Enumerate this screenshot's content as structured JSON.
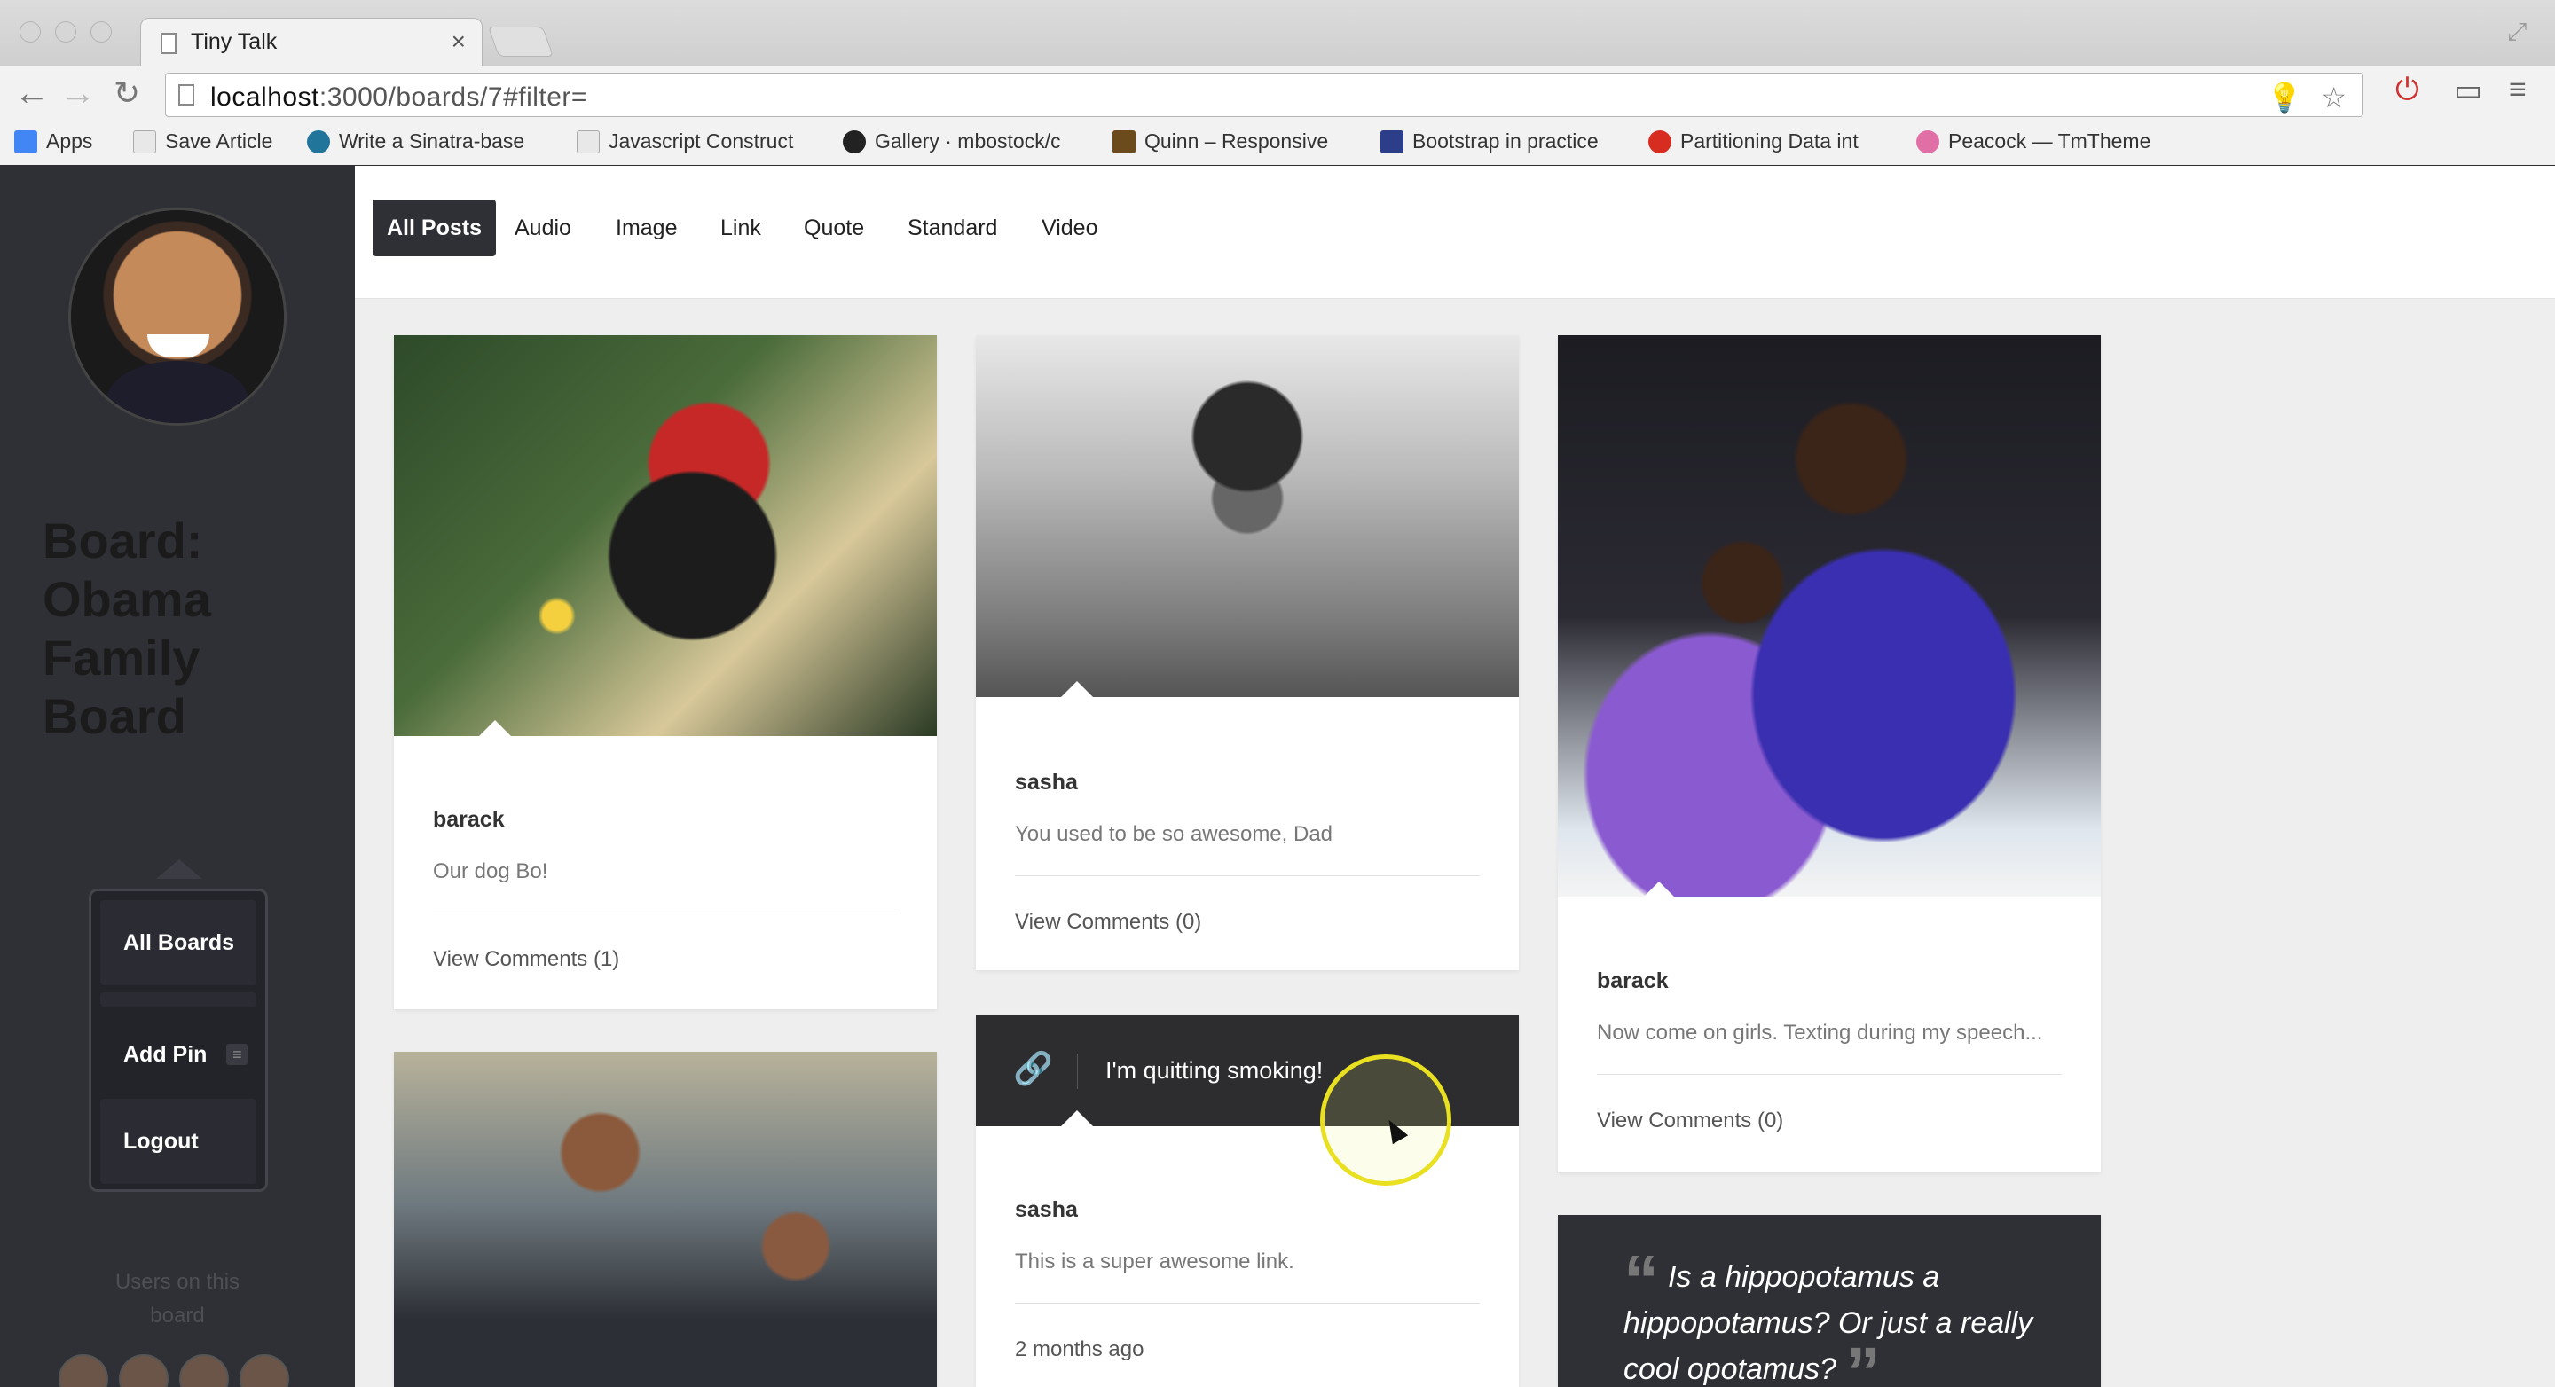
{
  "browser": {
    "tab_title": "Tiny Talk",
    "tab_close": "×",
    "url_host": "localhost",
    "url_rest": ":3000/boards/7#filter=",
    "bookmarks": [
      {
        "label": "Apps",
        "color": "#4285f4"
      },
      {
        "label": "Save Article",
        "color": "#cfcfcf"
      },
      {
        "label": "Write a Sinatra-base",
        "color": "#21759b"
      },
      {
        "label": "Javascript Construct",
        "color": "#cfcfcf"
      },
      {
        "label": "Gallery · mbostock/c",
        "color": "#222222"
      },
      {
        "label": "Quinn – Responsive",
        "color": "#6b4a1c"
      },
      {
        "label": "Bootstrap in practice",
        "color": "#2c3e8a"
      },
      {
        "label": "Partitioning Data int",
        "color": "#d62d20"
      },
      {
        "label": "Peacock — TmTheme",
        "color": "#e06fa6"
      }
    ]
  },
  "sidebar": {
    "board_title": "Board: Obama Family Board",
    "menu": [
      "All Boards",
      "Add Pin",
      "Logout"
    ],
    "add_pin_badge": "≡",
    "users_label": "Users on this board"
  },
  "filters": [
    "All Posts",
    "Audio",
    "Image",
    "Link",
    "Quote",
    "Standard",
    "Video"
  ],
  "posts": [
    {
      "type": "image",
      "author": "barack",
      "caption": "Our dog Bo!",
      "meta": "View Comments (1)"
    },
    {
      "type": "image",
      "author": "sasha",
      "caption": "You used to be so awesome, Dad",
      "meta": "View Comments (0)"
    },
    {
      "type": "image",
      "author": "barack",
      "caption": "Now come on girls. Texting during my speech...",
      "meta": "View Comments (0)"
    },
    {
      "type": "link",
      "title": "I'm quitting smoking!",
      "author": "sasha",
      "caption": "This is a super awesome link.",
      "meta": "2 months ago"
    },
    {
      "type": "quote",
      "text": "Is a hippopotamus a hippopotamus? Or just a really cool opotamus?"
    }
  ],
  "icons": {
    "back": "back-arrow-icon",
    "forward": "forward-arrow-icon",
    "reload": "reload-icon",
    "link": "link-icon",
    "quote": "quote-icon"
  },
  "colors": {
    "sidebar": "#2f3035",
    "active_filter": "#2f3035",
    "content_bg": "#eeeeee",
    "cursor_ring": "#e8e020"
  }
}
